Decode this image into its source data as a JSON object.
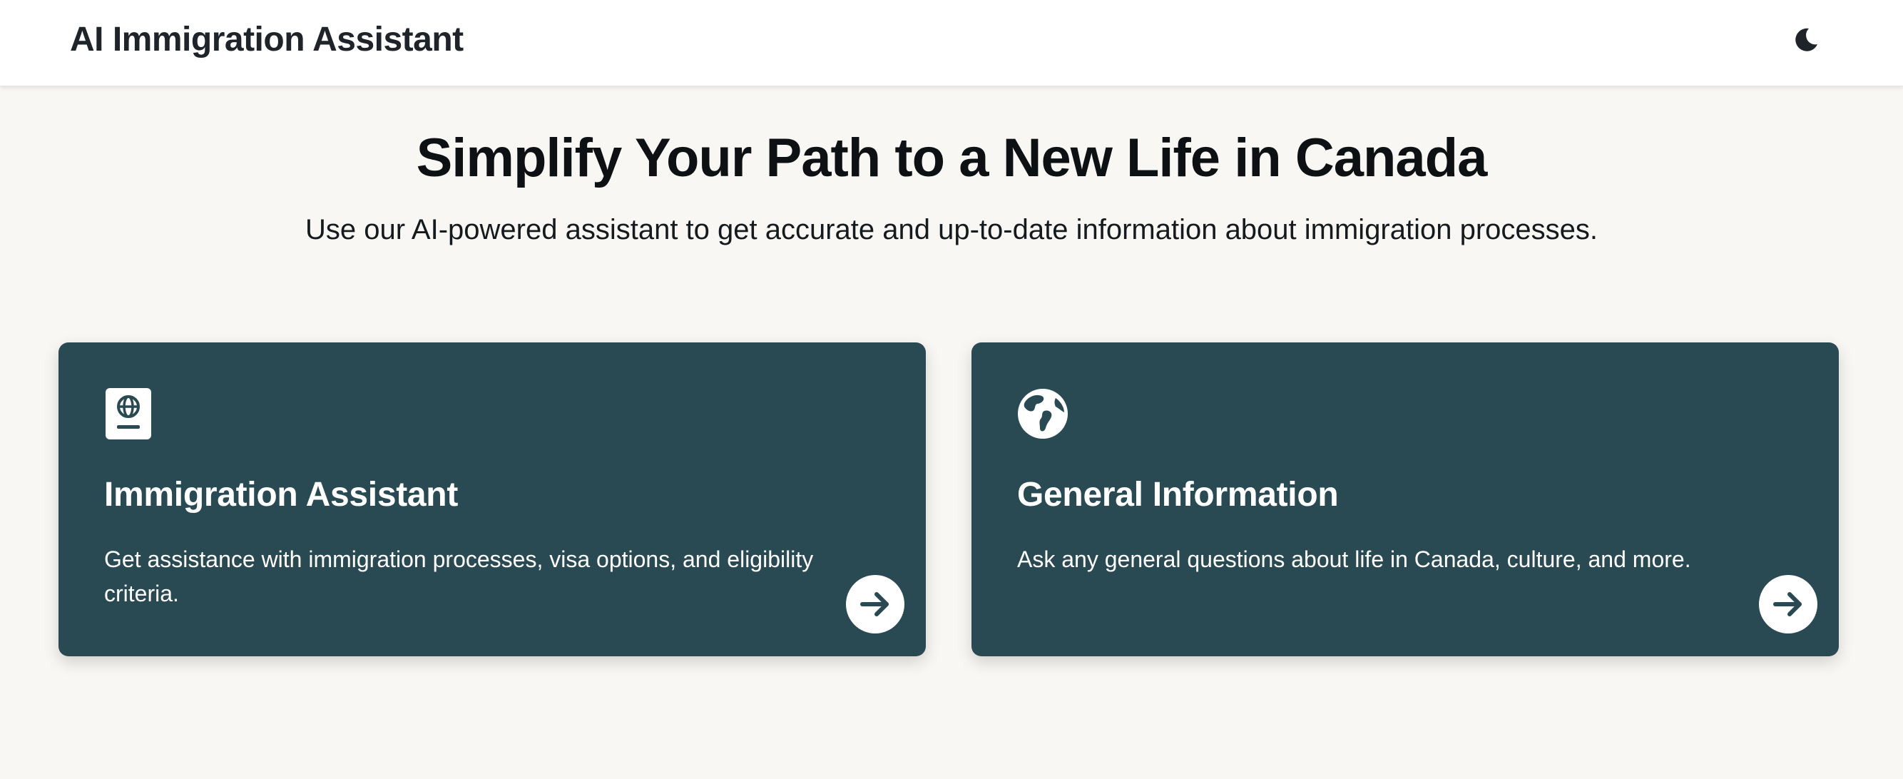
{
  "header": {
    "title": "AI Immigration Assistant",
    "theme_toggle_icon": "moon-icon"
  },
  "hero": {
    "title": "Simplify Your Path to a New Life in Canada",
    "subtitle": "Use our AI-powered assistant to get accurate and up-to-date information about immigration processes."
  },
  "cards": [
    {
      "icon": "passport-icon",
      "title": "Immigration Assistant",
      "description": "Get assistance with immigration processes, visa options, and eligibility criteria.",
      "action_icon": "arrow-right-icon"
    },
    {
      "icon": "globe-icon",
      "title": "General Information",
      "description": "Ask any general questions about life in Canada, culture, and more.",
      "action_icon": "arrow-right-icon"
    }
  ],
  "colors": {
    "card_background": "#294953",
    "page_background": "#f8f7f3",
    "header_background": "#ffffff",
    "text_dark": "#0d1114"
  }
}
